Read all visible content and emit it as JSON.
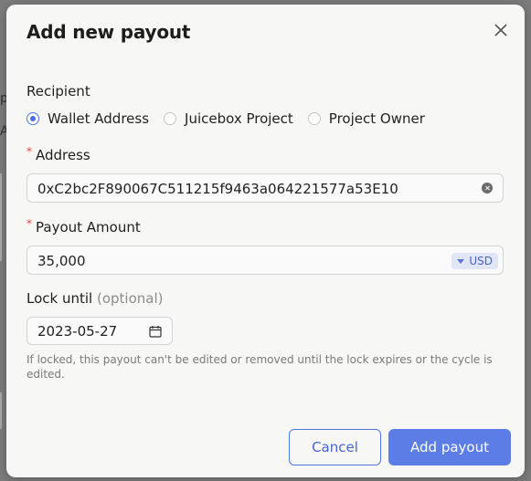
{
  "modal": {
    "title": "Add new payout",
    "close_glyph": "X"
  },
  "recipient": {
    "label": "Recipient",
    "options": [
      {
        "label": "Wallet Address",
        "checked": true
      },
      {
        "label": "Juicebox Project",
        "checked": false
      },
      {
        "label": "Project Owner",
        "checked": false
      }
    ]
  },
  "address": {
    "required_mark": "*",
    "label": "Address",
    "value": "0xC2bc2F890067C511215f9463a064221577a53E10"
  },
  "payout_amount": {
    "required_mark": "*",
    "label": "Payout Amount",
    "value": "35,000",
    "currency": "USD"
  },
  "lock": {
    "label": "Lock until",
    "optional": "(optional)",
    "date": "2023-05-27",
    "help": "If locked, this payout can't be edited or removed until the lock expires or the cycle is edited."
  },
  "actions": {
    "cancel": "Cancel",
    "add": "Add payout"
  },
  "colors": {
    "accent": "#5b7de5",
    "required": "#e8433d",
    "currency_bg": "#e1e6f7"
  },
  "icons": {
    "close": "close-icon",
    "clear": "clear-icon",
    "caret": "chevron-down-icon",
    "calendar": "calendar-icon"
  }
}
